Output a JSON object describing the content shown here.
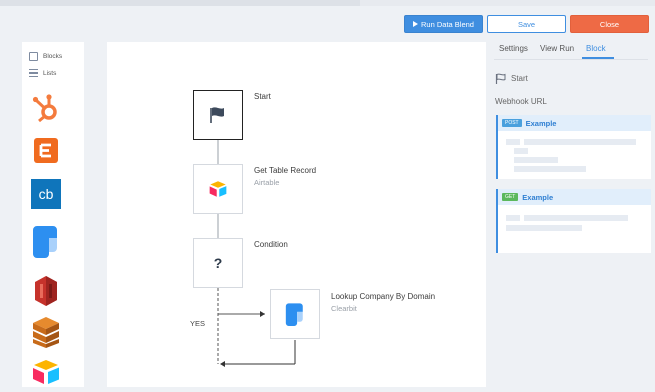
{
  "toolbar": {
    "run_label": "Run Data Blend",
    "save_label": "Save",
    "close_label": "Close",
    "run_color": "#3f8ee0",
    "close_color": "#ee6a45"
  },
  "palette": {
    "options": [
      {
        "label": "Blocks",
        "icon": "checkbox-icon"
      },
      {
        "label": "Lists",
        "icon": "list-icon"
      }
    ],
    "apps": [
      "hubspot-icon",
      "eventbrite-icon",
      "chargebee-icon",
      "clearbit-icon",
      "aws-icon",
      "aws-stack-icon",
      "airtable-icon"
    ]
  },
  "flow": {
    "nodes": [
      {
        "title": "Start",
        "subtitle": "",
        "icon": "flag-icon"
      },
      {
        "title": "Get Table Record",
        "subtitle": "Airtable",
        "icon": "airtable-icon"
      },
      {
        "title": "Condition",
        "subtitle": "",
        "icon": "question-icon"
      },
      {
        "title": "Lookup Company By Domain",
        "subtitle": "Clearbit",
        "icon": "clearbit-icon"
      }
    ],
    "branch_label": "YES"
  },
  "panel": {
    "tabs": [
      {
        "label": "Settings",
        "active": false
      },
      {
        "label": "View Run",
        "active": false
      },
      {
        "label": "Block",
        "active": true
      }
    ],
    "start_label": "Start",
    "webhook_label": "Webhook URL",
    "examples": [
      {
        "method": "POST",
        "title": "Example"
      },
      {
        "method": "GET",
        "title": "Example"
      }
    ]
  }
}
